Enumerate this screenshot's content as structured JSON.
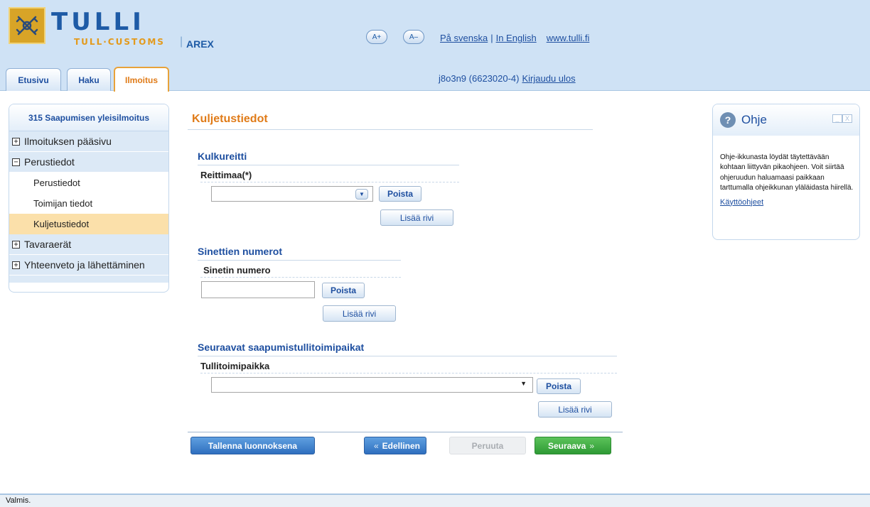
{
  "header": {
    "brand": "TULLI",
    "brand_sub": "TULL·CUSTOMS",
    "separator": "|",
    "app_name": "AREX",
    "font_plus": "A+",
    "font_minus": "A–",
    "lang_swedish": "På svenska",
    "lang_sep": "|",
    "lang_english": "In English",
    "site_link": "www.tulli.fi",
    "user": "j8o3n9 (6623020-4)",
    "logout": "Kirjaudu ulos",
    "logo_icon": "customs-emblem-icon"
  },
  "tabs": [
    {
      "label": "Etusivu"
    },
    {
      "label": "Haku"
    },
    {
      "label": "Ilmoitus"
    }
  ],
  "sidebar": {
    "title": "315 Saapumisen yleisilmoitus",
    "items": [
      {
        "label": "Ilmoituksen pääsivu",
        "toggle": "+"
      },
      {
        "label": "Perustiedot",
        "toggle": "−"
      },
      {
        "label": "Perustiedot"
      },
      {
        "label": "Toimijan tiedot"
      },
      {
        "label": "Kuljetustiedot"
      },
      {
        "label": "Tavaraerät",
        "toggle": "+"
      },
      {
        "label": "Yhteenveto ja lähettäminen",
        "toggle": "+"
      }
    ]
  },
  "main": {
    "title": "Kuljetustiedot",
    "route": {
      "title": "Kulkureitti",
      "label": "Reittimaa(*)",
      "value": "",
      "remove": "Poista",
      "add": "Lisää rivi"
    },
    "seals": {
      "title": "Sinettien numerot",
      "label": "Sinetin numero",
      "value": "",
      "remove": "Poista",
      "add": "Lisää rivi"
    },
    "offices": {
      "title": "Seuraavat saapumistullitoimipaikat",
      "label": "Tullitoimipaikka",
      "value": "",
      "remove": "Poista",
      "add": "Lisää rivi"
    },
    "actions": {
      "save": "Tallenna luonnoksena",
      "prev": "Edellinen",
      "cancel": "Peruuta",
      "next": "Seuraava"
    }
  },
  "help": {
    "icon": "?",
    "title": "Ohje",
    "minimize": "_",
    "close": "X",
    "body": "Ohje-ikkunasta löydät täytettävään kohtaan liittyvän pikaohjeen. Voit siirtää ohjeruudun haluamaasi paikkaan tarttumalla ohjeikkunan yläläidasta hiirellä.",
    "link": "Käyttöohjeet"
  },
  "status": "Valmis.",
  "colors": {
    "header_bg": "#cfe2f5",
    "brand_blue": "#1e5ba6",
    "accent_orange": "#e07b18",
    "active_nav": "#fbe0aa",
    "next_green": "#2e9a35"
  }
}
